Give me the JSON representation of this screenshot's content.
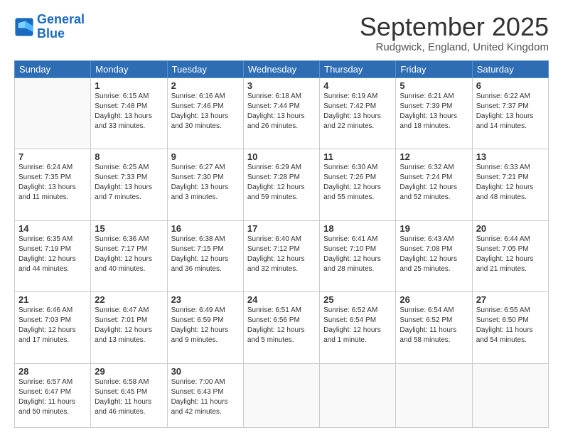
{
  "header": {
    "logo_general": "General",
    "logo_blue": "Blue",
    "month": "September 2025",
    "location": "Rudgwick, England, United Kingdom"
  },
  "weekdays": [
    "Sunday",
    "Monday",
    "Tuesday",
    "Wednesday",
    "Thursday",
    "Friday",
    "Saturday"
  ],
  "weeks": [
    [
      {
        "day": "",
        "info": ""
      },
      {
        "day": "1",
        "info": "Sunrise: 6:15 AM\nSunset: 7:48 PM\nDaylight: 13 hours\nand 33 minutes."
      },
      {
        "day": "2",
        "info": "Sunrise: 6:16 AM\nSunset: 7:46 PM\nDaylight: 13 hours\nand 30 minutes."
      },
      {
        "day": "3",
        "info": "Sunrise: 6:18 AM\nSunset: 7:44 PM\nDaylight: 13 hours\nand 26 minutes."
      },
      {
        "day": "4",
        "info": "Sunrise: 6:19 AM\nSunset: 7:42 PM\nDaylight: 13 hours\nand 22 minutes."
      },
      {
        "day": "5",
        "info": "Sunrise: 6:21 AM\nSunset: 7:39 PM\nDaylight: 13 hours\nand 18 minutes."
      },
      {
        "day": "6",
        "info": "Sunrise: 6:22 AM\nSunset: 7:37 PM\nDaylight: 13 hours\nand 14 minutes."
      }
    ],
    [
      {
        "day": "7",
        "info": "Sunrise: 6:24 AM\nSunset: 7:35 PM\nDaylight: 13 hours\nand 11 minutes."
      },
      {
        "day": "8",
        "info": "Sunrise: 6:25 AM\nSunset: 7:33 PM\nDaylight: 13 hours\nand 7 minutes."
      },
      {
        "day": "9",
        "info": "Sunrise: 6:27 AM\nSunset: 7:30 PM\nDaylight: 13 hours\nand 3 minutes."
      },
      {
        "day": "10",
        "info": "Sunrise: 6:29 AM\nSunset: 7:28 PM\nDaylight: 12 hours\nand 59 minutes."
      },
      {
        "day": "11",
        "info": "Sunrise: 6:30 AM\nSunset: 7:26 PM\nDaylight: 12 hours\nand 55 minutes."
      },
      {
        "day": "12",
        "info": "Sunrise: 6:32 AM\nSunset: 7:24 PM\nDaylight: 12 hours\nand 52 minutes."
      },
      {
        "day": "13",
        "info": "Sunrise: 6:33 AM\nSunset: 7:21 PM\nDaylight: 12 hours\nand 48 minutes."
      }
    ],
    [
      {
        "day": "14",
        "info": "Sunrise: 6:35 AM\nSunset: 7:19 PM\nDaylight: 12 hours\nand 44 minutes."
      },
      {
        "day": "15",
        "info": "Sunrise: 6:36 AM\nSunset: 7:17 PM\nDaylight: 12 hours\nand 40 minutes."
      },
      {
        "day": "16",
        "info": "Sunrise: 6:38 AM\nSunset: 7:15 PM\nDaylight: 12 hours\nand 36 minutes."
      },
      {
        "day": "17",
        "info": "Sunrise: 6:40 AM\nSunset: 7:12 PM\nDaylight: 12 hours\nand 32 minutes."
      },
      {
        "day": "18",
        "info": "Sunrise: 6:41 AM\nSunset: 7:10 PM\nDaylight: 12 hours\nand 28 minutes."
      },
      {
        "day": "19",
        "info": "Sunrise: 6:43 AM\nSunset: 7:08 PM\nDaylight: 12 hours\nand 25 minutes."
      },
      {
        "day": "20",
        "info": "Sunrise: 6:44 AM\nSunset: 7:05 PM\nDaylight: 12 hours\nand 21 minutes."
      }
    ],
    [
      {
        "day": "21",
        "info": "Sunrise: 6:46 AM\nSunset: 7:03 PM\nDaylight: 12 hours\nand 17 minutes."
      },
      {
        "day": "22",
        "info": "Sunrise: 6:47 AM\nSunset: 7:01 PM\nDaylight: 12 hours\nand 13 minutes."
      },
      {
        "day": "23",
        "info": "Sunrise: 6:49 AM\nSunset: 6:59 PM\nDaylight: 12 hours\nand 9 minutes."
      },
      {
        "day": "24",
        "info": "Sunrise: 6:51 AM\nSunset: 6:56 PM\nDaylight: 12 hours\nand 5 minutes."
      },
      {
        "day": "25",
        "info": "Sunrise: 6:52 AM\nSunset: 6:54 PM\nDaylight: 12 hours\nand 1 minute."
      },
      {
        "day": "26",
        "info": "Sunrise: 6:54 AM\nSunset: 6:52 PM\nDaylight: 11 hours\nand 58 minutes."
      },
      {
        "day": "27",
        "info": "Sunrise: 6:55 AM\nSunset: 6:50 PM\nDaylight: 11 hours\nand 54 minutes."
      }
    ],
    [
      {
        "day": "28",
        "info": "Sunrise: 6:57 AM\nSunset: 6:47 PM\nDaylight: 11 hours\nand 50 minutes."
      },
      {
        "day": "29",
        "info": "Sunrise: 6:58 AM\nSunset: 6:45 PM\nDaylight: 11 hours\nand 46 minutes."
      },
      {
        "day": "30",
        "info": "Sunrise: 7:00 AM\nSunset: 6:43 PM\nDaylight: 11 hours\nand 42 minutes."
      },
      {
        "day": "",
        "info": ""
      },
      {
        "day": "",
        "info": ""
      },
      {
        "day": "",
        "info": ""
      },
      {
        "day": "",
        "info": ""
      }
    ]
  ]
}
